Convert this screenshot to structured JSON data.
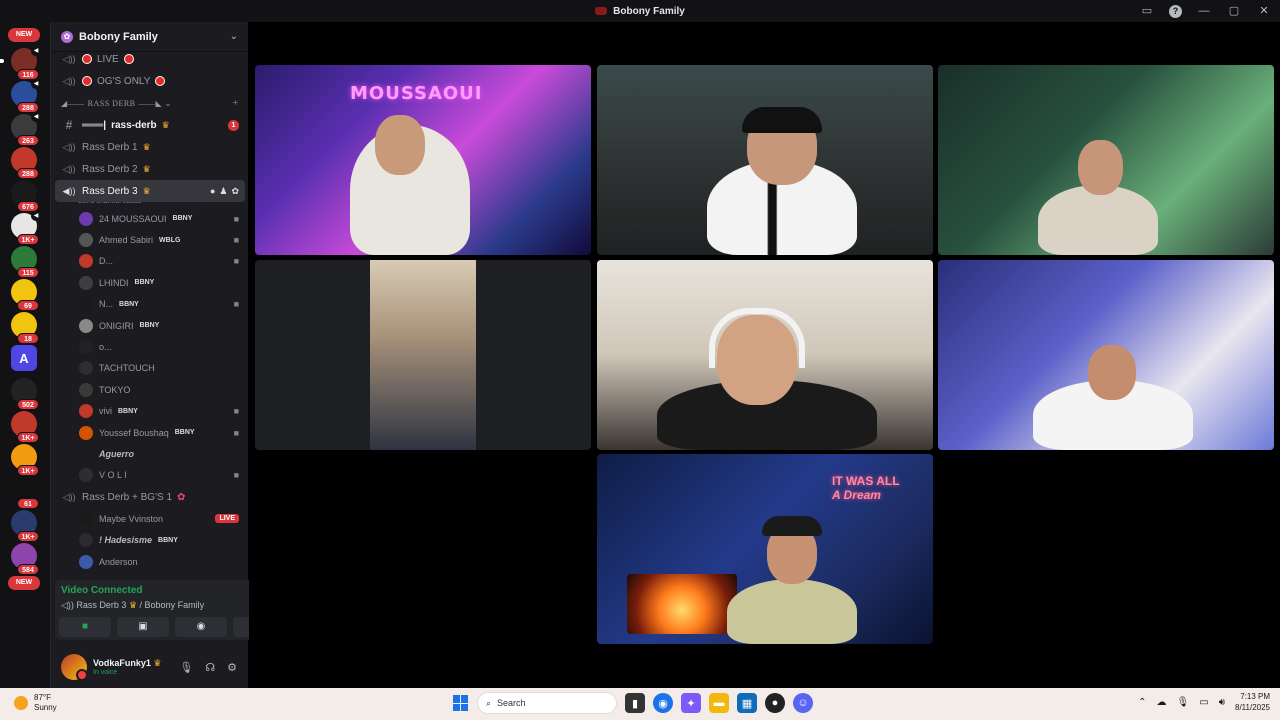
{
  "window": {
    "title": "Bobony Family"
  },
  "rail": {
    "badges": [
      "116",
      "288",
      "263",
      "288",
      "676",
      "1K+",
      "115",
      "69",
      "18",
      "",
      "502",
      "1K+",
      "1K+",
      "61",
      "1K+",
      "584"
    ],
    "new_label_top": "NEW",
    "new_label_bottom": "NEW"
  },
  "server": {
    "name": "Bobony Family"
  },
  "channels": {
    "live": "LIVE",
    "ogs_only": "OG'S ONLY",
    "category": "RASS DERB",
    "rass_derb_text": "rass-derb",
    "rass_derb_count": "1",
    "rass_derb_1": "Rass Derb 1",
    "rass_derb_2": "Rass Derb 2",
    "rass_derb_3": "Rass Derb 3",
    "status_placeholder": "Set a channel status",
    "rass_derb_bgs": "Rass Derb + BG'S 1"
  },
  "members": [
    {
      "name": "24 MOUSSAOUI",
      "tag": "BBNY",
      "cam": true
    },
    {
      "name": "Ahmed Sabiri",
      "tag": "WBLG",
      "cam": true
    },
    {
      "name": "D...",
      "tag": "",
      "cam": true
    },
    {
      "name": "LHINDI",
      "tag": "BBNY",
      "cam": false
    },
    {
      "name": "N...",
      "tag": "BBNY",
      "cam": true
    },
    {
      "name": "ONIGIRI",
      "tag": "BBNY",
      "cam": false
    },
    {
      "name": "o...",
      "tag": "",
      "cam": false
    },
    {
      "name": "TACHTOUCH",
      "tag": "",
      "cam": false
    },
    {
      "name": "TOKYO",
      "tag": "",
      "cam": false
    },
    {
      "name": "vivi",
      "tag": "BBNY",
      "cam": true
    },
    {
      "name": "Youssef Boushaq",
      "tag": "BBNY",
      "cam": true
    },
    {
      "name": "Aguerro",
      "tag": "",
      "cam": false
    },
    {
      "name": "V O L I",
      "tag": "",
      "cam": true
    }
  ],
  "members2": [
    {
      "name": "Maybe Vvinston",
      "live": "LIVE"
    },
    {
      "name": "! Hadesisme",
      "tag": "BBNY"
    },
    {
      "name": "Anderson"
    }
  ],
  "voice": {
    "status": "Video Connected",
    "channel": "Rass Derb 3",
    "server": "/ Bobony Family"
  },
  "user": {
    "name": "VodkaFunky1",
    "status": "In voice"
  },
  "stage": {
    "neon_1": "MOUSSAOUI",
    "neon_7_line1": "IT WAS ALL",
    "neon_7_line2": "A Dream"
  },
  "taskbar": {
    "temp": "87°F",
    "condition": "Sunny",
    "search_placeholder": "Search",
    "time": "7:13 PM",
    "date": "8/11/2025"
  },
  "colors": {
    "accent": "#da373c",
    "connected": "#23a55a",
    "crown": "#f0b232"
  }
}
